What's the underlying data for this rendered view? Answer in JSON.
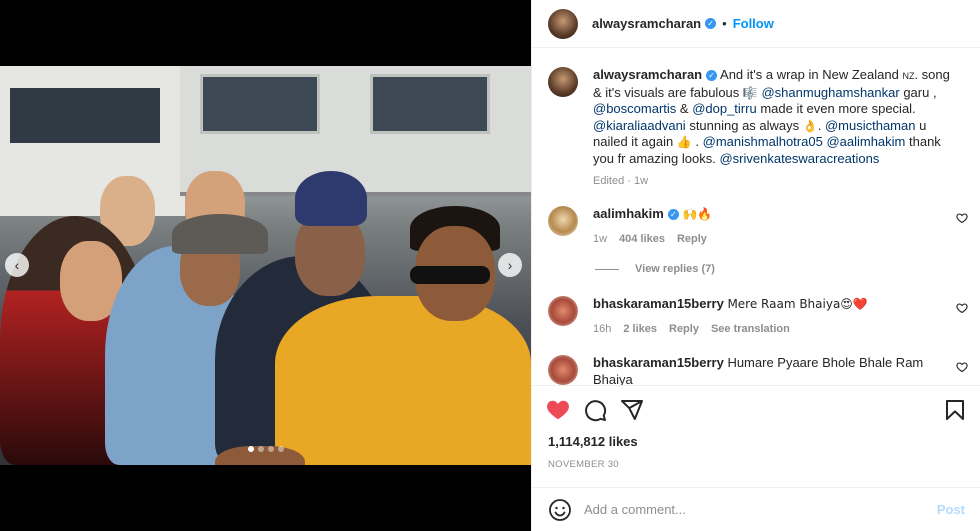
{
  "post": {
    "username": "alwaysramcharan",
    "follow_label": "Follow",
    "dot": "•",
    "caption_intro": "And it's a wrap in New Zealand",
    "caption_nz": "NZ",
    "caption_line2": ". song & it's visuals are fabulous",
    "caption_emoji1": "🎼",
    "mention1": "@shanmughamshankar",
    "caption_garu": " garu ,",
    "mention2": "@boscomartis",
    "caption_amp": " & ",
    "mention3": "@dop_tirru",
    "caption_made": " made it even more special.",
    "mention4": "@kiaraliaadvani",
    "caption_stunning": " stunning as always",
    "caption_emoji2": "👌",
    "caption_dot": ". ",
    "mention5": "@musicthaman",
    "caption_nailed": " u nailed it again",
    "caption_emoji3": "👍",
    "caption_dot2": " . ",
    "mention6": "@manishmalhotra05",
    "mention7": "@aalimhakim",
    "caption_thanks": " thank you fr amazing looks.",
    "mention8": "@srivenkateswaracreations",
    "edited_meta": "Edited · 1w",
    "likes": "1,114,812 likes",
    "date": "NOVEMBER 30"
  },
  "comments": [
    {
      "username": "aalimhakim",
      "text": "🙌🔥",
      "time": "1w",
      "likes": "404 likes",
      "reply": "Reply"
    },
    {
      "username": "bhaskaraman15berry",
      "text": "Mere Raam Bhaiya😍❤️",
      "time": "16h",
      "likes": "2 likes",
      "reply": "Reply",
      "translate": "See translation"
    },
    {
      "username": "bhaskaraman15berry",
      "text": "Humare Pyaare Bhole Bhale Ram Bhaiya",
      "text2": "😍"
    }
  ],
  "view_replies": "View replies (7)",
  "add_comment": {
    "placeholder": "Add a comment...",
    "post_label": "Post"
  },
  "carousel": {
    "prev_label": "‹",
    "next_label": "›",
    "total_slides": 4,
    "active_slide": 1
  },
  "icons": [
    "heart-icon",
    "comment-icon",
    "share-icon",
    "save-icon",
    "emoji-icon",
    "verified-icon",
    "small-heart-icon"
  ],
  "colors": {
    "accent": "#0095f6",
    "liked_heart": "#ed4956",
    "mention": "#00376b",
    "muted": "#8e8e8e",
    "verified": "#3897f0"
  }
}
